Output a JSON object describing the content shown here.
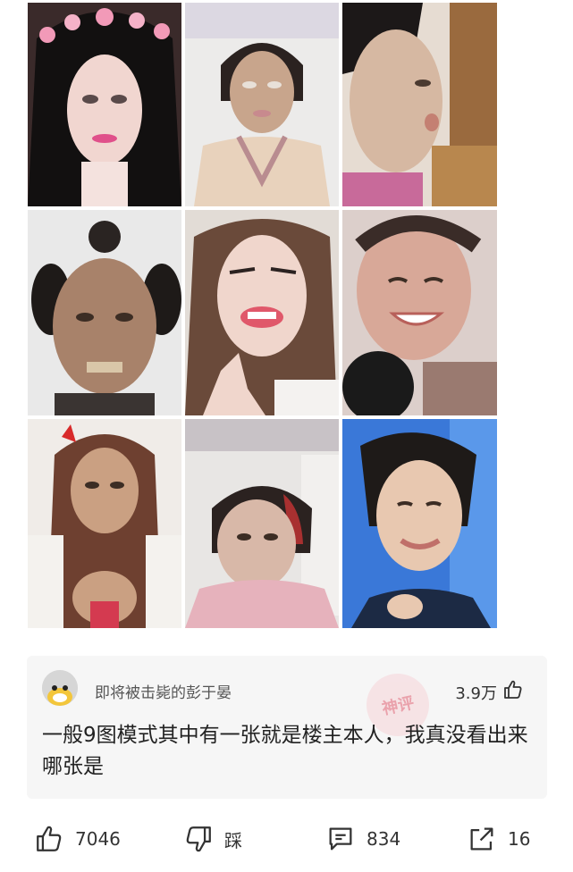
{
  "photos": [
    {
      "desc": "photo-1"
    },
    {
      "desc": "photo-2"
    },
    {
      "desc": "photo-3"
    },
    {
      "desc": "photo-4"
    },
    {
      "desc": "photo-5"
    },
    {
      "desc": "photo-6"
    },
    {
      "desc": "photo-7"
    },
    {
      "desc": "photo-8"
    },
    {
      "desc": "photo-9"
    }
  ],
  "hot_comment": {
    "username": "即将被击毙的彭于晏",
    "likes": "3.9万",
    "text": "一般9图模式其中有一张就是楼主本人，我真没看出来哪张是",
    "badge": "神评"
  },
  "actions": {
    "like_count": "7046",
    "dislike_label": "踩",
    "comment_count": "834",
    "share_count": "16"
  },
  "colors": {
    "badge": "#e25e70",
    "card_bg": "#f6f6f6",
    "text": "#222222"
  }
}
